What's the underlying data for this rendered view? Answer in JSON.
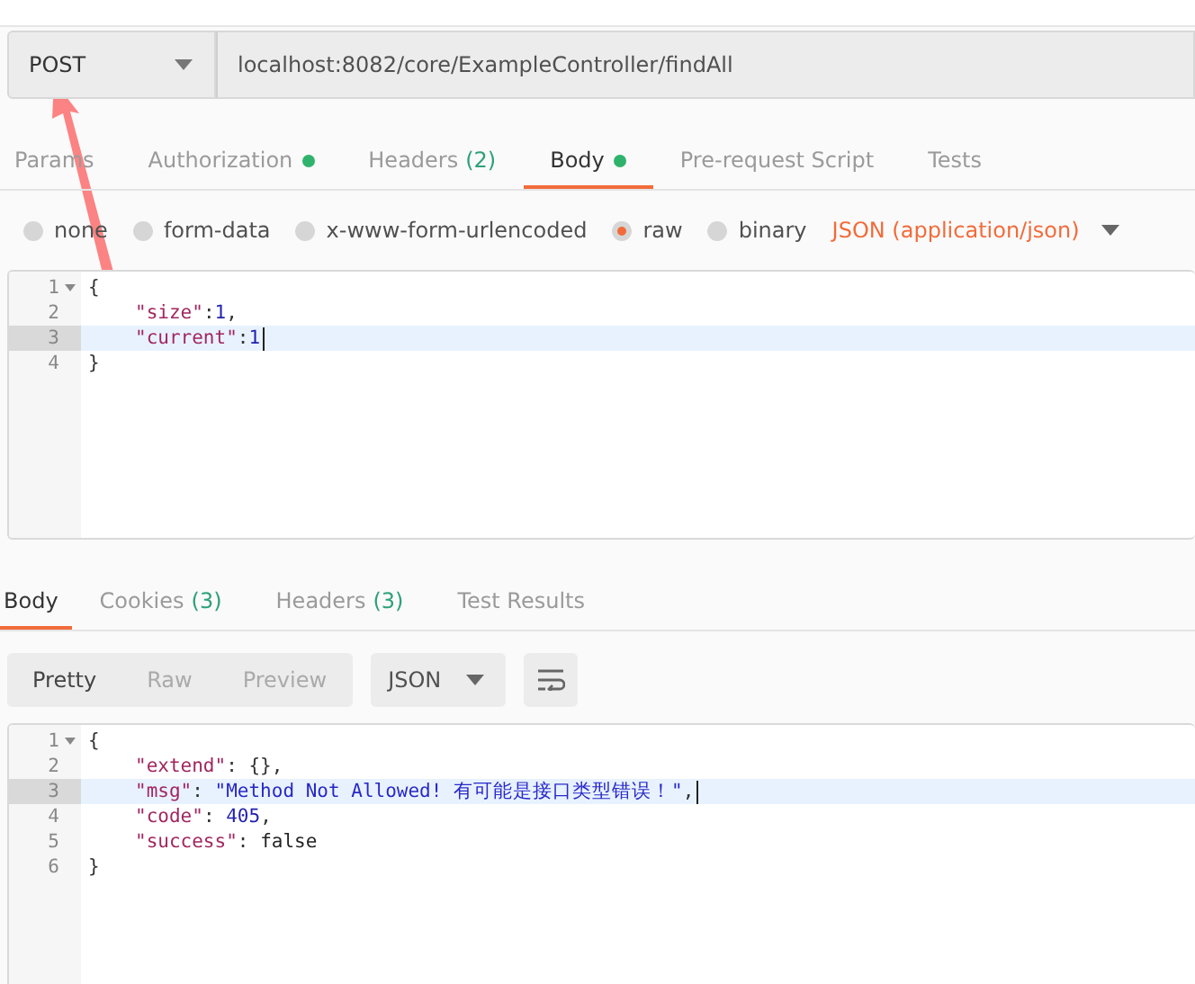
{
  "request": {
    "method": "POST",
    "url": "localhost:8082/core/ExampleController/findAll"
  },
  "request_tabs": [
    {
      "label": "Params",
      "dot": false,
      "selected": false
    },
    {
      "label": "Authorization",
      "dot": true,
      "selected": false
    },
    {
      "label": "Headers",
      "count": "(2)",
      "dot": false,
      "selected": false
    },
    {
      "label": "Body",
      "dot": true,
      "selected": true
    },
    {
      "label": "Pre-request Script",
      "dot": false,
      "selected": false
    },
    {
      "label": "Tests",
      "dot": false,
      "selected": false
    }
  ],
  "body_types": [
    {
      "label": "none",
      "selected": false
    },
    {
      "label": "form-data",
      "selected": false
    },
    {
      "label": "x-www-form-urlencoded",
      "selected": false
    },
    {
      "label": "raw",
      "selected": true
    },
    {
      "label": "binary",
      "selected": false
    }
  ],
  "body_format": "JSON (application/json)",
  "request_editor": {
    "lines": [
      {
        "number": "1",
        "fold": true,
        "active": false,
        "indented": false,
        "cursor": false,
        "tokens": [
          {
            "kind": "punct",
            "text": "{"
          }
        ]
      },
      {
        "number": "2",
        "fold": false,
        "active": false,
        "indented": true,
        "cursor": false,
        "tokens": [
          {
            "kind": "key",
            "text": "\"size\""
          },
          {
            "kind": "punct",
            "text": ":"
          },
          {
            "kind": "number",
            "text": "1"
          },
          {
            "kind": "punct",
            "text": ","
          }
        ]
      },
      {
        "number": "3",
        "fold": false,
        "active": true,
        "indented": true,
        "cursor": true,
        "tokens": [
          {
            "kind": "key",
            "text": "\"current\""
          },
          {
            "kind": "punct",
            "text": ":"
          },
          {
            "kind": "number",
            "text": "1"
          }
        ]
      },
      {
        "number": "4",
        "fold": false,
        "active": false,
        "indented": false,
        "cursor": false,
        "tokens": [
          {
            "kind": "punct",
            "text": "}"
          }
        ]
      }
    ]
  },
  "response_tabs": [
    {
      "label": "Body",
      "selected": true
    },
    {
      "label": "Cookies",
      "count": "(3)",
      "selected": false
    },
    {
      "label": "Headers",
      "count": "(3)",
      "selected": false
    },
    {
      "label": "Test Results",
      "selected": false
    }
  ],
  "view_modes": [
    {
      "label": "Pretty",
      "selected": true
    },
    {
      "label": "Raw",
      "selected": false
    },
    {
      "label": "Preview",
      "selected": false
    }
  ],
  "response_format": "JSON",
  "response_editor": {
    "lines": [
      {
        "number": "1",
        "fold": true,
        "active": false,
        "indented": false,
        "cursor": false,
        "tokens": [
          {
            "kind": "punct",
            "text": "{"
          }
        ]
      },
      {
        "number": "2",
        "fold": false,
        "active": false,
        "indented": true,
        "cursor": false,
        "tokens": [
          {
            "kind": "key",
            "text": "\"extend\""
          },
          {
            "kind": "punct",
            "text": ": {},"
          }
        ]
      },
      {
        "number": "3",
        "fold": false,
        "active": true,
        "indented": true,
        "cursor": true,
        "tokens": [
          {
            "kind": "key",
            "text": "\"msg\""
          },
          {
            "kind": "punct",
            "text": ": "
          },
          {
            "kind": "string",
            "text": "\"Method Not Allowed! 有可能是接口类型错误！\""
          },
          {
            "kind": "punct",
            "text": ","
          }
        ]
      },
      {
        "number": "4",
        "fold": false,
        "active": false,
        "indented": true,
        "cursor": false,
        "tokens": [
          {
            "kind": "key",
            "text": "\"code\""
          },
          {
            "kind": "punct",
            "text": ": "
          },
          {
            "kind": "number",
            "text": "405"
          },
          {
            "kind": "punct",
            "text": ","
          }
        ]
      },
      {
        "number": "5",
        "fold": false,
        "active": false,
        "indented": true,
        "cursor": false,
        "tokens": [
          {
            "kind": "key",
            "text": "\"success\""
          },
          {
            "kind": "punct",
            "text": ": "
          },
          {
            "kind": "bool",
            "text": "false"
          }
        ]
      },
      {
        "number": "6",
        "fold": false,
        "active": false,
        "indented": false,
        "cursor": false,
        "tokens": [
          {
            "kind": "punct",
            "text": "}"
          }
        ]
      }
    ]
  }
}
